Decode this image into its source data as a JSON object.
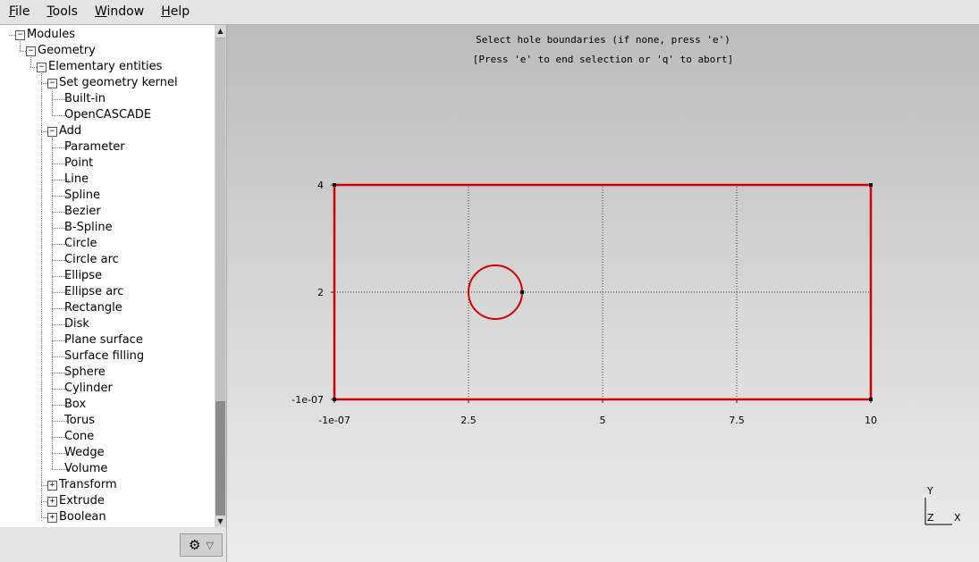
{
  "menu": [
    "File",
    "Tools",
    "Window",
    "Help"
  ],
  "tree": [
    {
      "label": "Modules",
      "depth": 0,
      "toggle": "-"
    },
    {
      "label": "Geometry",
      "depth": 1,
      "toggle": "-"
    },
    {
      "label": "Elementary entities",
      "depth": 2,
      "toggle": "-"
    },
    {
      "label": "Set geometry kernel",
      "depth": 3,
      "toggle": "-"
    },
    {
      "label": "Built-in",
      "depth": 4,
      "toggle": ""
    },
    {
      "label": "OpenCASCADE",
      "depth": 4,
      "toggle": ""
    },
    {
      "label": "Add",
      "depth": 3,
      "toggle": "-"
    },
    {
      "label": "Parameter",
      "depth": 4,
      "toggle": ""
    },
    {
      "label": "Point",
      "depth": 4,
      "toggle": ""
    },
    {
      "label": "Line",
      "depth": 4,
      "toggle": ""
    },
    {
      "label": "Spline",
      "depth": 4,
      "toggle": ""
    },
    {
      "label": "Bezier",
      "depth": 4,
      "toggle": ""
    },
    {
      "label": "B-Spline",
      "depth": 4,
      "toggle": ""
    },
    {
      "label": "Circle",
      "depth": 4,
      "toggle": ""
    },
    {
      "label": "Circle arc",
      "depth": 4,
      "toggle": ""
    },
    {
      "label": "Ellipse",
      "depth": 4,
      "toggle": ""
    },
    {
      "label": "Ellipse arc",
      "depth": 4,
      "toggle": ""
    },
    {
      "label": "Rectangle",
      "depth": 4,
      "toggle": ""
    },
    {
      "label": "Disk",
      "depth": 4,
      "toggle": ""
    },
    {
      "label": "Plane surface",
      "depth": 4,
      "toggle": ""
    },
    {
      "label": "Surface filling",
      "depth": 4,
      "toggle": ""
    },
    {
      "label": "Sphere",
      "depth": 4,
      "toggle": ""
    },
    {
      "label": "Cylinder",
      "depth": 4,
      "toggle": ""
    },
    {
      "label": "Box",
      "depth": 4,
      "toggle": ""
    },
    {
      "label": "Torus",
      "depth": 4,
      "toggle": ""
    },
    {
      "label": "Cone",
      "depth": 4,
      "toggle": ""
    },
    {
      "label": "Wedge",
      "depth": 4,
      "toggle": ""
    },
    {
      "label": "Volume",
      "depth": 4,
      "toggle": ""
    },
    {
      "label": "Transform",
      "depth": 3,
      "toggle": "+"
    },
    {
      "label": "Extrude",
      "depth": 3,
      "toggle": "+"
    },
    {
      "label": "Boolean",
      "depth": 3,
      "toggle": "+"
    }
  ],
  "messages": {
    "line1": "Select hole boundaries (if none, press 'e')",
    "line2": "[Press 'e' to end selection or 'q' to abort]"
  },
  "axes": {
    "x_ticks": [
      "-1e-07",
      "2.5",
      "5",
      "7.5",
      "10"
    ],
    "y_ticks": [
      "4",
      "2",
      "-1e-07"
    ],
    "x_values": [
      0,
      2.5,
      5,
      7.5,
      10
    ],
    "y_values": [
      4,
      2,
      0
    ]
  },
  "geometry": {
    "rectangle": {
      "x0": 0,
      "y0": 0,
      "x1": 10,
      "y1": 4
    },
    "circle": {
      "cx": 3,
      "cy": 2,
      "r": 0.5
    },
    "color": "#d40000"
  },
  "axis_widget": {
    "y": "Y",
    "z": "Z",
    "x": "X"
  }
}
